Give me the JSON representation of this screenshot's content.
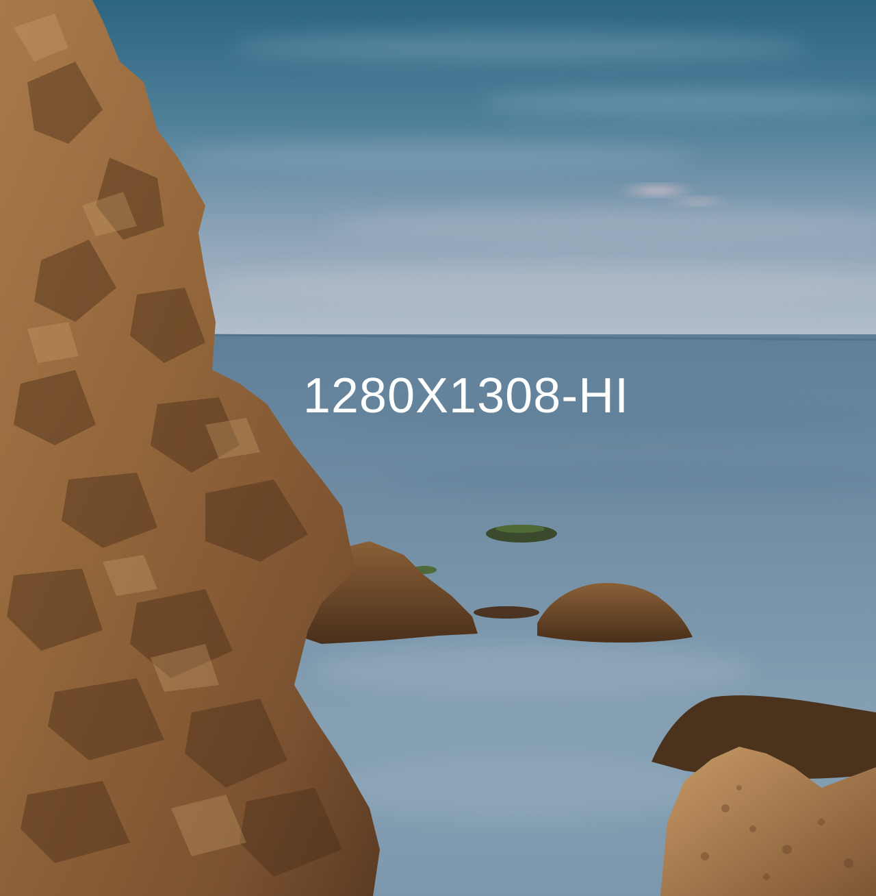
{
  "overlay": {
    "text": "1280X1308-HI"
  },
  "scene": {
    "description_kind": "photograph",
    "colors": {
      "sky_top": "#2f6884",
      "sky_mid": "#5d87a0",
      "sky_low": "#9fb1c2",
      "horizon_glow": "#cdb8c2",
      "sea_far": "#6d8ba2",
      "sea_near": "#8ea6b8",
      "rock_light": "#b98a55",
      "rock_mid": "#8a5f35",
      "rock_dark": "#4e321b",
      "algae": "#3f5a2e"
    }
  }
}
